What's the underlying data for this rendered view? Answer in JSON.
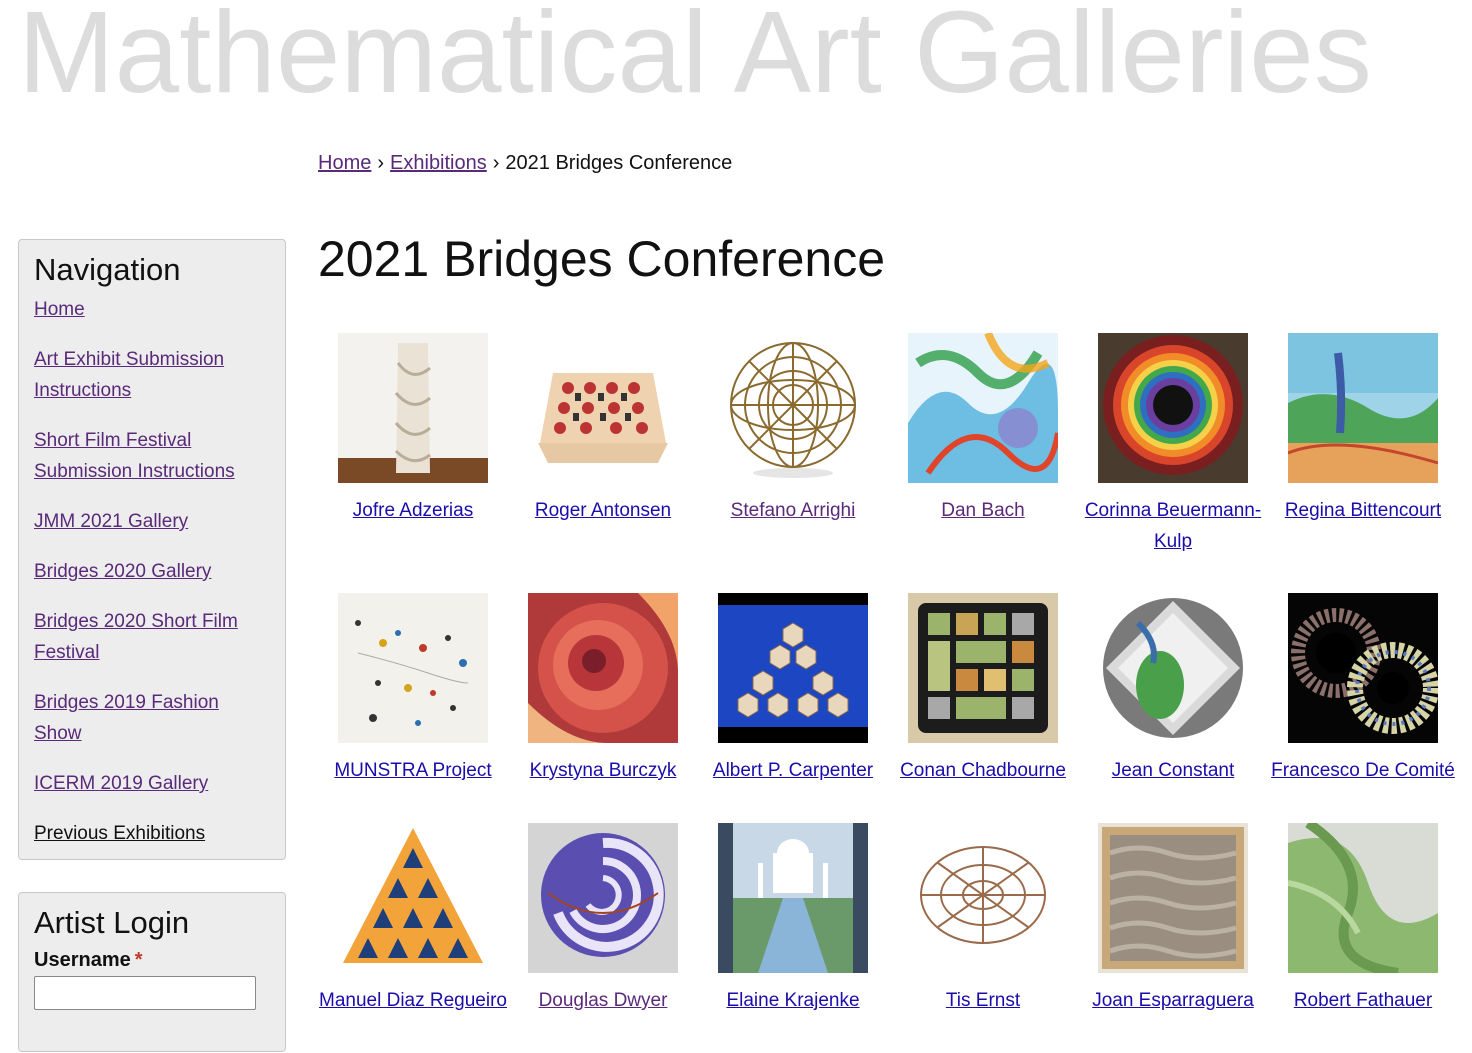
{
  "site": {
    "title": "Mathematical Art Galleries"
  },
  "breadcrumb": {
    "items": [
      "Home",
      "Exhibitions"
    ],
    "current": "2021 Bridges Conference",
    "separator": "›"
  },
  "page": {
    "title": "2021 Bridges Conference"
  },
  "navigation": {
    "heading": "Navigation",
    "items": [
      {
        "label": "Home"
      },
      {
        "label": "Art Exhibit Submission Instructions"
      },
      {
        "label": "Short Film Festival Submission Instructions"
      },
      {
        "label": "JMM 2021 Gallery"
      },
      {
        "label": "Bridges 2020 Gallery"
      },
      {
        "label": "Bridges 2020 Short Film Festival"
      },
      {
        "label": "Bridges 2019 Fashion Show"
      },
      {
        "label": "ICERM 2019 Gallery"
      },
      {
        "label": "Previous Exhibitions"
      }
    ]
  },
  "login": {
    "heading": "Artist Login",
    "username_label": "Username",
    "required_marker": "*"
  },
  "gallery": {
    "rows": [
      [
        {
          "artist": "Jofre Adzerias",
          "icon": "twisted-column-sculpture"
        },
        {
          "artist": "Roger Antonsen",
          "icon": "grid-knot-board"
        },
        {
          "artist": "Stefano Arrighi",
          "icon": "wire-sphere"
        },
        {
          "artist": "Dan Bach",
          "icon": "colorful-surface-render"
        },
        {
          "artist": "Corinna Beuermann-Kulp",
          "icon": "rainbow-spiral-paper"
        },
        {
          "artist": "Regina Bittencourt",
          "icon": "watercolor-landscape"
        }
      ],
      [
        {
          "artist": "MUNSTRA Project",
          "icon": "scattered-dots"
        },
        {
          "artist": "Krystyna Burczyk",
          "icon": "paper-rose"
        },
        {
          "artist": "Albert P. Carpenter",
          "icon": "fractal-hex-sculpture"
        },
        {
          "artist": "Conan Chadbourne",
          "icon": "tiled-square-grid"
        },
        {
          "artist": "Jean Constant",
          "icon": "glass-diamond"
        },
        {
          "artist": "Francesco De Comité",
          "icon": "woven-tori"
        }
      ],
      [
        {
          "artist": "Manuel Diaz Regueiro",
          "icon": "tetrahedral-pyramid"
        },
        {
          "artist": "Douglas Dwyer",
          "icon": "spiral-sphere"
        },
        {
          "artist": "Elaine Krajenke",
          "icon": "taj-mahal-quilt"
        },
        {
          "artist": "Tis Ernst",
          "icon": "wire-polyhedron"
        },
        {
          "artist": "Joan Esparraguera",
          "icon": "woven-panel"
        },
        {
          "artist": "Robert Fathauer",
          "icon": "green-ceramic-curves"
        }
      ]
    ]
  },
  "colors": {
    "title_gray": "#dcdcdc",
    "link_visited": "#5a2a7a",
    "link": "#1a0dab",
    "panel_bg": "#ededed",
    "required": "#c0392b"
  }
}
